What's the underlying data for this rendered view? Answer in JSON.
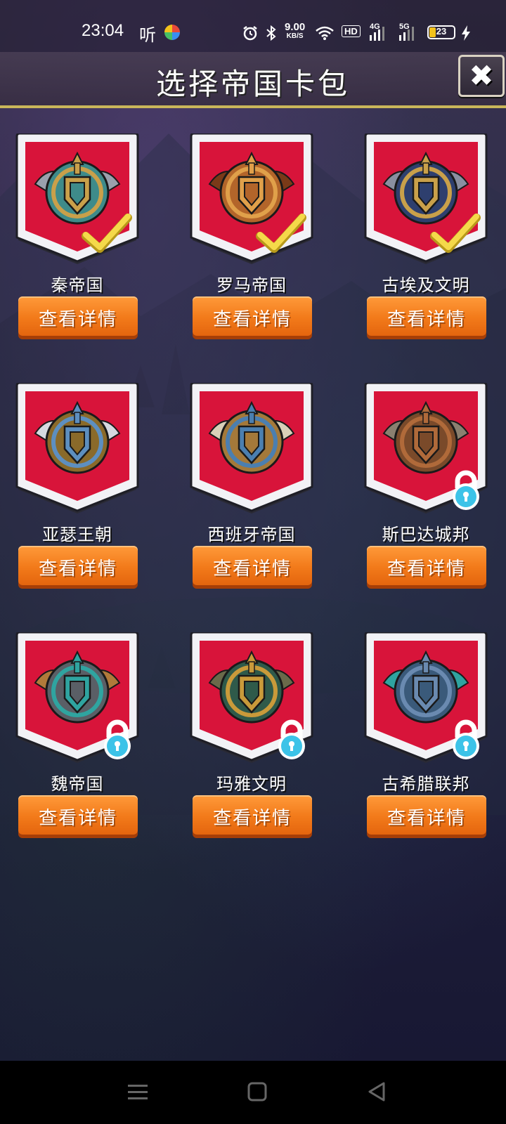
{
  "status_bar": {
    "time": "23:04",
    "listen_label": "听",
    "net_speed_value": "9.00",
    "net_speed_unit": "KB/S",
    "hd_label": "HD",
    "sig1_label": "4G",
    "sig2_label": "5G",
    "battery_level": "23",
    "icons": [
      "alarm-icon",
      "bluetooth-icon",
      "wifi-icon",
      "signal-icon",
      "signal-icon",
      "battery-icon",
      "charging-icon"
    ]
  },
  "header": {
    "title": "选择帝国卡包",
    "close_icon": "close-icon"
  },
  "cards": [
    {
      "name": "秦帝国",
      "button": "查看详情",
      "state": "selected",
      "emblem": "qin-emblem"
    },
    {
      "name": "罗马帝国",
      "button": "查看详情",
      "state": "selected",
      "emblem": "rome-emblem"
    },
    {
      "name": "古埃及文明",
      "button": "查看详情",
      "state": "selected",
      "emblem": "egypt-emblem"
    },
    {
      "name": "亚瑟王朝",
      "button": "查看详情",
      "state": "available",
      "emblem": "arthur-emblem"
    },
    {
      "name": "西班牙帝国",
      "button": "查看详情",
      "state": "available",
      "emblem": "spain-emblem"
    },
    {
      "name": "斯巴达城邦",
      "button": "查看详情",
      "state": "locked",
      "emblem": "sparta-emblem"
    },
    {
      "name": "魏帝国",
      "button": "查看详情",
      "state": "locked",
      "emblem": "wei-emblem"
    },
    {
      "name": "玛雅文明",
      "button": "查看详情",
      "state": "locked",
      "emblem": "maya-emblem"
    },
    {
      "name": "古希腊联邦",
      "button": "查看详情",
      "state": "locked",
      "emblem": "greece-emblem"
    }
  ],
  "colors": {
    "banner_red": "#d8143a",
    "button_orange": "#f27a1a",
    "check_yellow": "#f5d94a",
    "lock_blue": "#3cc3e8"
  },
  "nav": {
    "items": [
      "menu-icon",
      "home-icon",
      "back-icon"
    ]
  }
}
